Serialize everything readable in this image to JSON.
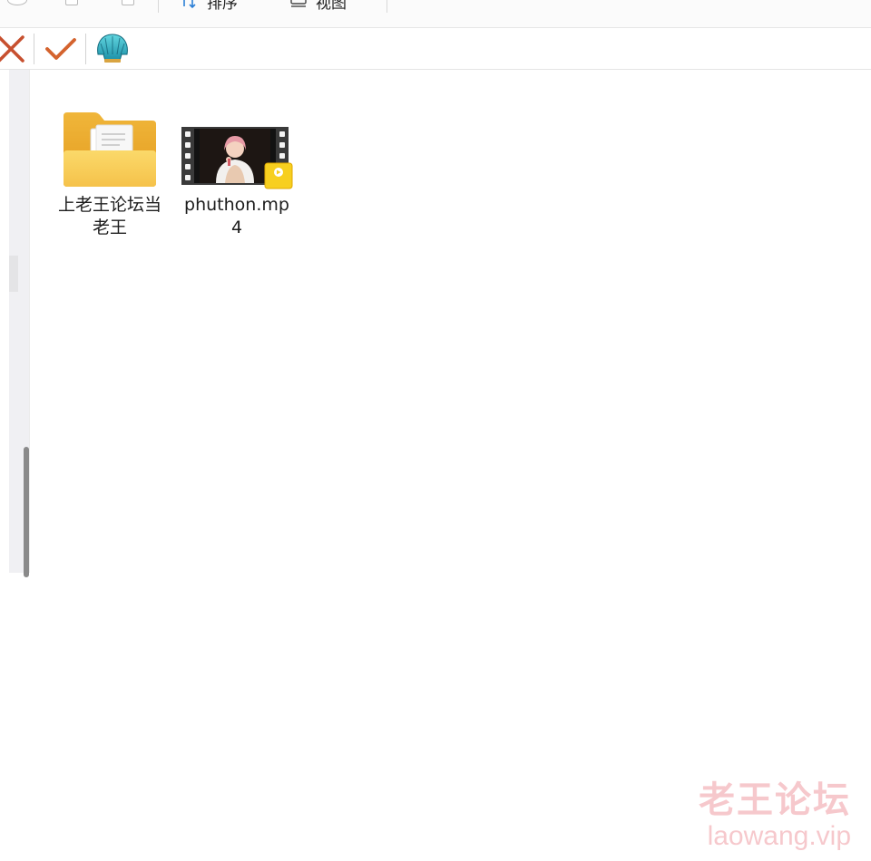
{
  "ribbon": {
    "sort_label": "排序",
    "view_label": "视图"
  },
  "actionbar": {
    "close_icon": "close-x-icon",
    "check_icon": "checkmark-icon",
    "shell_icon": "shell-icon",
    "colors": {
      "close": "#c7502f",
      "check": "#d4632e"
    }
  },
  "files": {
    "items": [
      {
        "name": "上老王论坛当老王",
        "type": "folder",
        "icon": "folder-icon"
      },
      {
        "name": "phuthon.mp4",
        "type": "video",
        "icon": "video-file-icon",
        "badge": "Player"
      }
    ]
  },
  "watermark": {
    "line1": "老王论坛",
    "line2": "laowang.vip"
  }
}
